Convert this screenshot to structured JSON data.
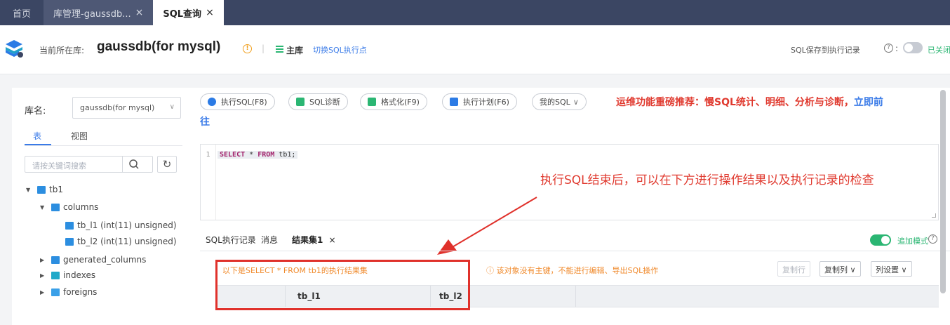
{
  "tabs": [
    {
      "label": "首页"
    },
    {
      "label": "库管理-gaussdb...",
      "close": "×"
    },
    {
      "label": "SQL查询",
      "close": "×"
    }
  ],
  "header": {
    "current_label": "当前所在库:",
    "current_db": "gaussdb(for mysql)",
    "master_label": "主库",
    "switch_link": "切换SQL执行点",
    "save_label": "SQL保存到执行记录",
    "help": "?",
    "colon": ":",
    "toggle_state": "已关闭"
  },
  "sidebar": {
    "lib_label": "库名:",
    "lib_value": "gaussdb(for mysql)",
    "tabs": [
      "表",
      "视图"
    ],
    "search_placeholder": "请按关键词搜索",
    "tree": [
      {
        "label": "tb1",
        "expanded": true
      },
      {
        "label": "columns",
        "expanded": true
      },
      {
        "label": "tb_l1 (int(11) unsigned)"
      },
      {
        "label": "tb_l2 (int(11) unsigned)"
      },
      {
        "label": "generated_columns"
      },
      {
        "label": "indexes"
      },
      {
        "label": "foreigns"
      }
    ]
  },
  "toolbar": {
    "execute": "执行SQL(F8)",
    "diagnose": "SQL诊断",
    "format": "格式化(F9)",
    "plan": "执行计划(F6)",
    "my_sql": "我的SQL",
    "promo": "运维功能重磅推荐：慢SQL统计、明细、分析与诊断，",
    "promo_link_1": "立即前",
    "promo_link_2": "往"
  },
  "editor": {
    "line_number": "1",
    "kw_select": "SELECT",
    "mid": " * ",
    "kw_from": "FROM",
    "table": " tb1;"
  },
  "annotation": {
    "note": "执行SQL结束后，可以在下方进行操作结果以及执行记录的检查"
  },
  "results": {
    "tabs": [
      "SQL执行记录",
      "消息",
      "结果集1"
    ],
    "close": "×",
    "append_label": "追加模式",
    "caption": "以下是SELECT * FROM tb1的执行结果集",
    "warning": "该对象没有主键，不能进行编辑、导出SQL操作",
    "buttons": {
      "copy_row": "复制行",
      "copy_col": "复制列",
      "col_settings": "列设置"
    },
    "columns": [
      "tb_l1",
      "tb_l2"
    ]
  },
  "colors": {
    "accent": "#3a7be8",
    "warn": "#e03a2f",
    "success": "#2bb673",
    "topbar": "#3b4663"
  }
}
